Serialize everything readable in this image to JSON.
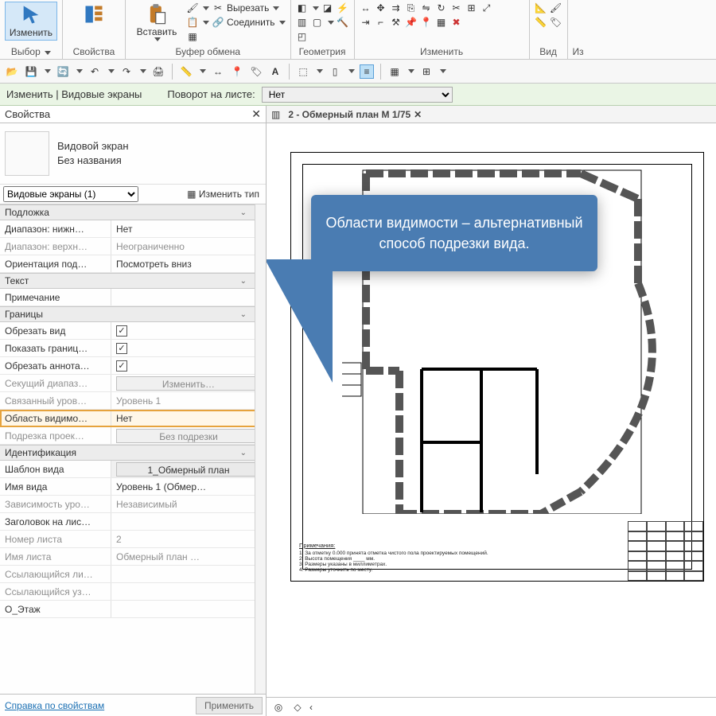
{
  "ribbon": {
    "groups": {
      "select": {
        "label": "Выбор",
        "btn": "Изменить"
      },
      "props": {
        "label": "Свойства"
      },
      "clipboard": {
        "label": "Буфер обмена",
        "paste": "Вставить",
        "cut": "Вырезать",
        "join": "Соединить"
      },
      "geometry": {
        "label": "Геометрия"
      },
      "modify": {
        "label": "Изменить"
      },
      "view": {
        "label": "Вид"
      },
      "iz": {
        "label": "Из"
      }
    }
  },
  "optbar": {
    "context": "Изменить | Видовые экраны",
    "rotLabel": "Поворот на листе:",
    "rotValue": "Нет"
  },
  "propsPanel": {
    "title": "Свойства",
    "type1": "Видовой экран",
    "type2": "Без названия",
    "filter": "Видовые экраны (1)",
    "editType": "Изменить тип",
    "help": "Справка по свойствам",
    "apply": "Применить",
    "groups": {
      "underlay": "Подложка",
      "text": "Текст",
      "bounds": "Границы",
      "ident": "Идентификация"
    },
    "rows": {
      "rangeBottom": {
        "k": "Диапазон: нижн…",
        "v": "Нет"
      },
      "rangeTop": {
        "k": "Диапазон: верхн…",
        "v": "Неограниченно"
      },
      "orient": {
        "k": "Ориентация под…",
        "v": "Посмотреть вниз"
      },
      "note": {
        "k": "Примечание",
        "v": ""
      },
      "crop": {
        "k": "Обрезать вид"
      },
      "showBound": {
        "k": "Показать границ…"
      },
      "cropAnno": {
        "k": "Обрезать аннота…"
      },
      "cutRange": {
        "k": "Секущий диапаз…",
        "v": "Изменить…"
      },
      "linkedLvl": {
        "k": "Связанный уров…",
        "v": "Уровень 1"
      },
      "visRegion": {
        "k": "Область видимо…",
        "v": "Нет"
      },
      "projCut": {
        "k": "Подрезка проек…",
        "v": "Без подрезки"
      },
      "template": {
        "k": "Шаблон вида",
        "v": "1_Обмерный план"
      },
      "viewName": {
        "k": "Имя вида",
        "v": "Уровень 1 (Обмер…"
      },
      "depend": {
        "k": "Зависимость уро…",
        "v": "Независимый"
      },
      "titleOnSheet": {
        "k": "Заголовок на лис…",
        "v": ""
      },
      "sheetNum": {
        "k": "Номер листа",
        "v": "2"
      },
      "sheetName": {
        "k": "Имя листа",
        "v": "Обмерный план …"
      },
      "refBy": {
        "k": "Ссылающийся ли…",
        "v": ""
      },
      "refNode": {
        "k": "Ссылающийся уз…",
        "v": ""
      },
      "ofloor": {
        "k": "О_Этаж",
        "v": ""
      }
    }
  },
  "tab": {
    "label": "2 - Обмерный план М 1/75"
  },
  "callout": "Области видимости – альтернативный способ подрезки вида.",
  "notes": {
    "heading": "Примечания:",
    "l1": "1.   За отметку 0.000 принята отметка чистого пола проектируемых помещений.",
    "l2": "2.   Высота помещения ____ мм.",
    "l3": "3.   Размеры указаны в миллиметрах.",
    "l4": "4.   Размеры уточнить по месту."
  }
}
